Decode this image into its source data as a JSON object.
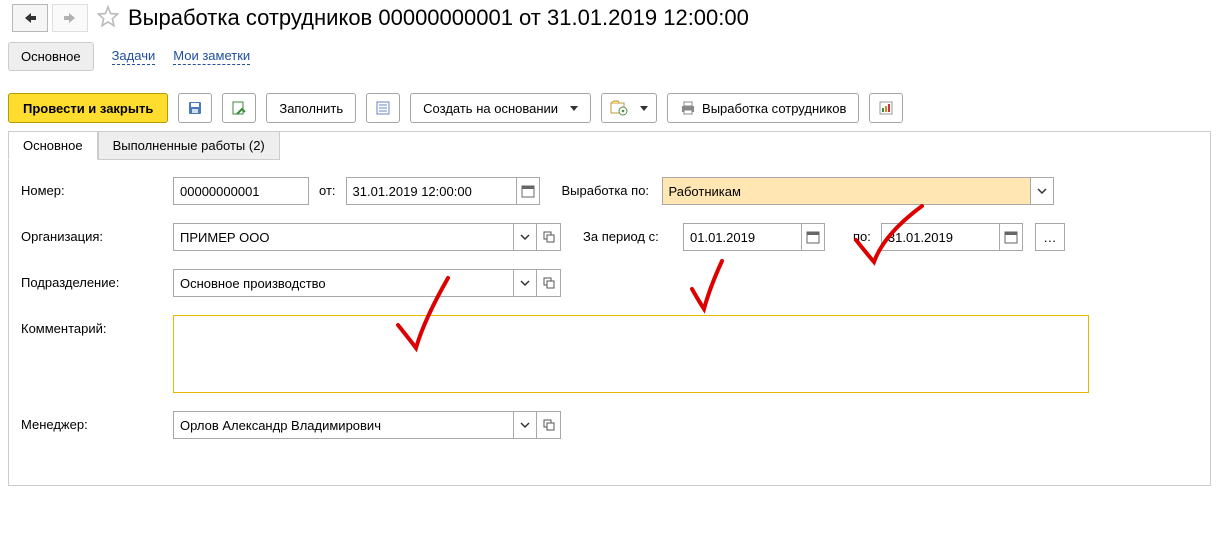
{
  "header": {
    "title": "Выработка сотрудников 00000000001 от 31.01.2019 12:00:00"
  },
  "subnav": {
    "active": "Основное",
    "links": [
      "Задачи",
      "Мои заметки"
    ]
  },
  "toolbar": {
    "post_close": "Провести и закрыть",
    "fill": "Заполнить",
    "create_based": "Создать на основании",
    "print": "Выработка сотрудников"
  },
  "tabs": {
    "main": "Основное",
    "works": "Выполненные работы (2)"
  },
  "labels": {
    "number": "Номер:",
    "from": "от:",
    "org": "Организация:",
    "dept": "Подразделение:",
    "comment": "Комментарий:",
    "manager": "Менеджер:",
    "vyrab_po": "Выработка по:",
    "period_from": "За период с:",
    "period_to": "по:"
  },
  "values": {
    "number": "00000000001",
    "datetime": "31.01.2019 12:00:00",
    "org": "ПРИМЕР ООО",
    "dept": "Основное производство",
    "manager": "Орлов Александр Владимирович",
    "comment": "",
    "vyrab_po": "Работникам",
    "date_from": "01.01.2019",
    "date_to": "31.01.2019"
  }
}
